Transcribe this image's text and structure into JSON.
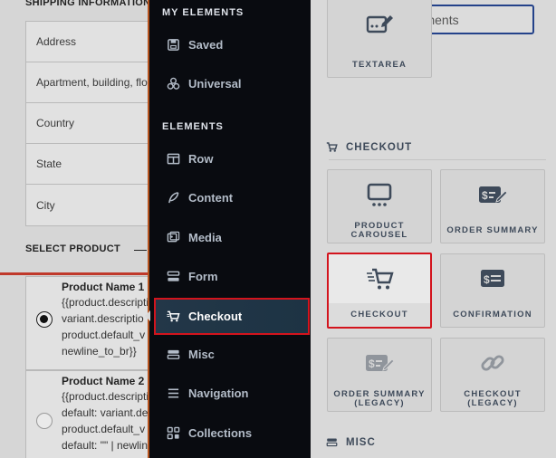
{
  "form": {
    "shipping_heading": "SHIPPING INFORMATION",
    "fields": [
      "Address",
      "Apartment, building, flo",
      "Country",
      "State",
      "City"
    ],
    "select_heading": "SELECT PRODUCT",
    "products": [
      {
        "name": "Product Name 1",
        "desc": "{{product.descripti\nvariant.descriptio\nproduct.default_v\nnewline_to_br}}",
        "selected": true
      },
      {
        "name": "Product Name 2",
        "desc": "{{product.descripti\ndefault: variant.de\nproduct.default_v\ndefault: \"\" | newlin",
        "selected": false
      }
    ]
  },
  "sidebar": {
    "my_elements_heading": "MY ELEMENTS",
    "elements_heading": "ELEMENTS",
    "my_items": [
      {
        "label": "Saved",
        "icon": "save-icon"
      },
      {
        "label": "Universal",
        "icon": "universal-icon"
      }
    ],
    "items": [
      {
        "label": "Row",
        "icon": "row-icon"
      },
      {
        "label": "Content",
        "icon": "feather-icon"
      },
      {
        "label": "Media",
        "icon": "media-icon"
      },
      {
        "label": "Form",
        "icon": "form-icon"
      },
      {
        "label": "Checkout",
        "icon": "cart-icon",
        "active": true
      },
      {
        "label": "Misc",
        "icon": "misc-icon"
      },
      {
        "label": "Navigation",
        "icon": "menu-icon"
      },
      {
        "label": "Collections",
        "icon": "collections-icon"
      }
    ],
    "active_color": "#d3141d"
  },
  "panel": {
    "search_placeholder": "Search Elements",
    "textarea_label": "TEXTAREA",
    "checkout_section": "CHECKOUT",
    "cards": [
      {
        "label": "PRODUCT CAROUSEL",
        "icon": "carousel-icon"
      },
      {
        "label": "ORDER SUMMARY",
        "icon": "order-summary-icon"
      },
      {
        "label": "CHECKOUT",
        "icon": "checkout-cart-icon",
        "highlighted": true
      },
      {
        "label": "CONFIRMATION",
        "icon": "confirmation-icon"
      },
      {
        "label": "ORDER SUMMARY (LEGACY)",
        "icon": "order-summary-legacy-icon"
      },
      {
        "label": "CHECKOUT (LEGACY)",
        "icon": "link-icon"
      }
    ],
    "misc_section": "MISC"
  }
}
